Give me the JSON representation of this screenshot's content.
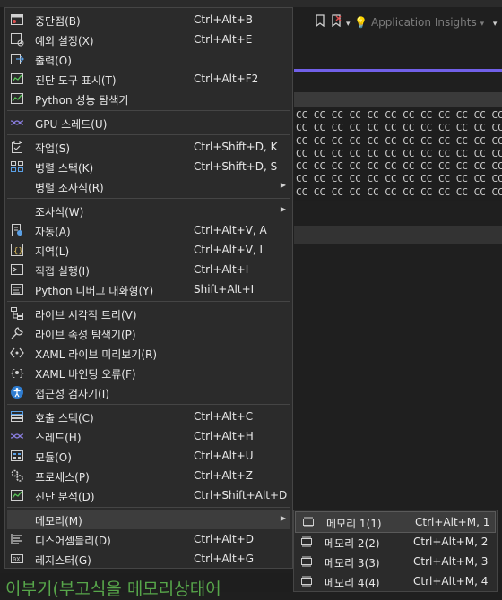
{
  "toolbar": {
    "insights_label": "Application Insights"
  },
  "memory_grid": {
    "rows": [
      "CC CC CC CC CC CC CC CC CC CC CC CC CC",
      "CC CC CC CC CC CC CC CC CC CC CC CC CC",
      "CC CC CC CC CC CC CC CC CC CC CC CC CC",
      "CC CC CC CC CC CC CC CC CC CC CC CC CC",
      "CC CC CC CC CC CC CC CC CC CC CC CC CC",
      "CC CC CC CC CC CC CC CC CC CC CC CC CC",
      "CC CC CC CC CC CC CC CC CC CC CC CC CC"
    ]
  },
  "background_text": "이부기(부고식을 메모리상태어",
  "menu": {
    "items": [
      {
        "label": "중단점(B)",
        "shortcut": "Ctrl+Alt+B",
        "icon": "breakpoints-icon"
      },
      {
        "label": "예외 설정(X)",
        "shortcut": "Ctrl+Alt+E",
        "icon": "exception-settings-icon"
      },
      {
        "label": "출력(O)",
        "shortcut": "",
        "icon": "output-icon"
      },
      {
        "label": "진단 도구 표시(T)",
        "shortcut": "Ctrl+Alt+F2",
        "icon": "diagnostic-tools-icon"
      },
      {
        "label": "Python 성능 탐색기",
        "shortcut": "",
        "icon": "python-performance-icon"
      },
      {
        "label": "GPU 스레드(U)",
        "shortcut": "",
        "icon": "gpu-threads-icon"
      },
      {
        "label": "작업(S)",
        "shortcut": "Ctrl+Shift+D, K",
        "icon": "tasks-icon"
      },
      {
        "label": "병렬 스택(K)",
        "shortcut": "Ctrl+Shift+D, S",
        "icon": "parallel-stacks-icon"
      },
      {
        "label": "병렬 조사식(R)",
        "shortcut": "",
        "icon": ""
      },
      {
        "label": "조사식(W)",
        "shortcut": "",
        "icon": ""
      },
      {
        "label": "자동(A)",
        "shortcut": "Ctrl+Alt+V, A",
        "icon": "autos-icon"
      },
      {
        "label": "지역(L)",
        "shortcut": "Ctrl+Alt+V, L",
        "icon": "locals-icon"
      },
      {
        "label": "직접 실행(I)",
        "shortcut": "Ctrl+Alt+I",
        "icon": "immediate-icon"
      },
      {
        "label": "Python 디버그 대화형(Y)",
        "shortcut": "Shift+Alt+I",
        "icon": "python-interactive-icon"
      },
      {
        "label": "라이브 시각적 트리(V)",
        "shortcut": "",
        "icon": "live-visual-tree-icon"
      },
      {
        "label": "라이브 속성 탐색기(P)",
        "shortcut": "",
        "icon": "live-property-explorer-icon"
      },
      {
        "label": "XAML 라이브 미리보기(R)",
        "shortcut": "",
        "icon": "xaml-preview-icon"
      },
      {
        "label": "XAML 바인딩 오류(F)",
        "shortcut": "",
        "icon": "xaml-binding-icon"
      },
      {
        "label": "접근성 검사기(I)",
        "shortcut": "",
        "icon": "accessibility-icon"
      },
      {
        "label": "호출 스택(C)",
        "shortcut": "Ctrl+Alt+C",
        "icon": "call-stack-icon"
      },
      {
        "label": "스레드(H)",
        "shortcut": "Ctrl+Alt+H",
        "icon": "threads-icon"
      },
      {
        "label": "모듈(O)",
        "shortcut": "Ctrl+Alt+U",
        "icon": "modules-icon"
      },
      {
        "label": "프로세스(P)",
        "shortcut": "Ctrl+Alt+Z",
        "icon": "processes-icon"
      },
      {
        "label": "진단 분석(D)",
        "shortcut": "Ctrl+Shift+Alt+D",
        "icon": "diagnostic-analysis-icon"
      },
      {
        "label": "메모리(M)",
        "shortcut": "",
        "icon": ""
      },
      {
        "label": "디스어셈블리(D)",
        "shortcut": "Ctrl+Alt+D",
        "icon": "disassembly-icon"
      },
      {
        "label": "레지스터(G)",
        "shortcut": "Ctrl+Alt+G",
        "icon": "registers-icon"
      }
    ]
  },
  "submenu": {
    "items": [
      {
        "label": "메모리 1(1)",
        "shortcut": "Ctrl+Alt+M, 1",
        "icon": "memory-icon"
      },
      {
        "label": "메모리 2(2)",
        "shortcut": "Ctrl+Alt+M, 2",
        "icon": "memory-icon"
      },
      {
        "label": "메모리 3(3)",
        "shortcut": "Ctrl+Alt+M, 3",
        "icon": "memory-icon"
      },
      {
        "label": "메모리 4(4)",
        "shortcut": "Ctrl+Alt+M, 4",
        "icon": "memory-icon"
      }
    ]
  },
  "colors": {
    "accent": "#7160e8",
    "icon_blue": "#5aa0e6",
    "code_green": "#57a64a"
  }
}
